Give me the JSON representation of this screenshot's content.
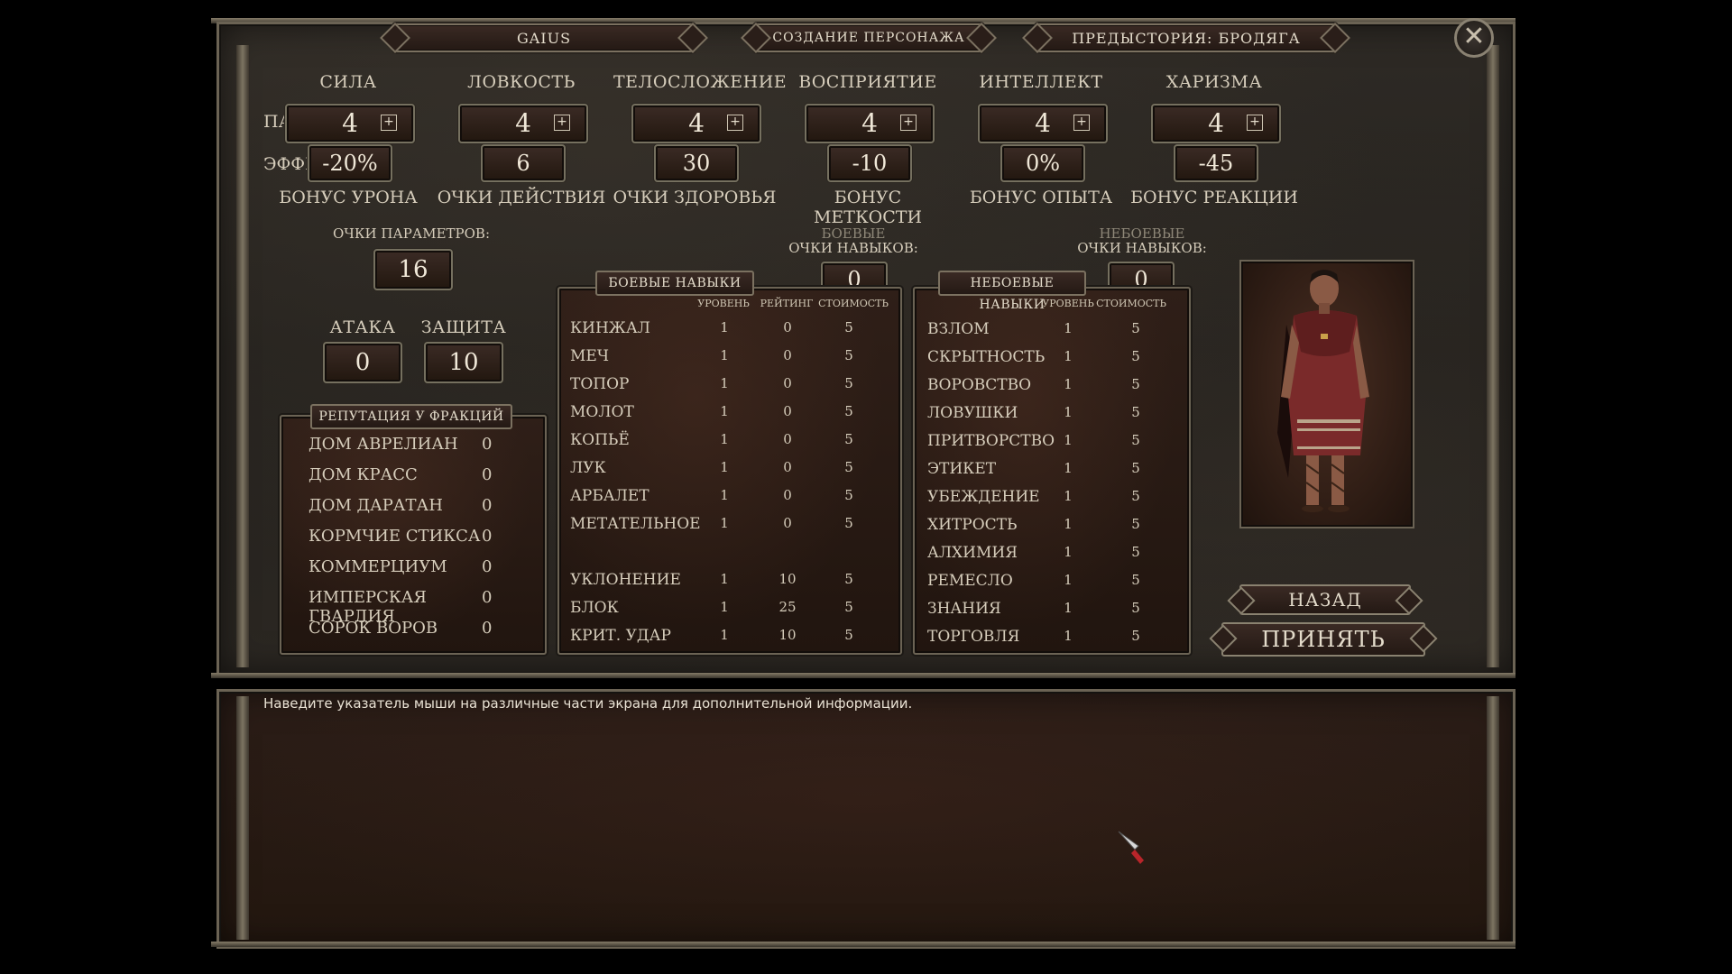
{
  "header": {
    "character_name": "GAIUS",
    "screen_title": "СОЗДАНИЕ ПЕРСОНАЖА",
    "background": "ПРЕДЫСТОРИЯ:  БРОДЯГА"
  },
  "labels": {
    "parameter": "ПАРАМЕТР:",
    "effect": "ЭФФЕКТ:",
    "attribute_points": "ОЧКИ ПАРАМЕТРОВ:",
    "attack": "АТАКА",
    "defense": "ЗАЩИТА",
    "combat_points_line1": "БОЕВЫЕ",
    "combat_points_line2": "ОЧКИ НАВЫКОВ:",
    "noncombat_points_line1": "НЕБОЕВЫЕ",
    "noncombat_points_line2": "ОЧКИ НАВЫКОВ:",
    "reputation": "РЕПУТАЦИЯ У ФРАКЦИЙ",
    "combat_skills": "БОЕВЫЕ НАВЫКИ",
    "noncombat_skills": "НЕБОЕВЫЕ НАВЫКИ",
    "col_level": "УРОВЕНЬ",
    "col_rating": "РЕЙТИНГ",
    "col_cost": "СТОИМОСТЬ",
    "plus": "+"
  },
  "attributes": [
    {
      "name": "СИЛА",
      "value": "4",
      "effect": "-20%",
      "bonus": "БОНУС УРОНА"
    },
    {
      "name": "ЛОВКОСТЬ",
      "value": "4",
      "effect": "6",
      "bonus": "ОЧКИ ДЕЙСТВИЯ"
    },
    {
      "name": "ТЕЛОСЛОЖЕНИЕ",
      "value": "4",
      "effect": "30",
      "bonus": "ОЧКИ ЗДОРОВЬЯ"
    },
    {
      "name": "ВОСПРИЯТИЕ",
      "value": "4",
      "effect": "-10",
      "bonus": "БОНУС МЕТКОСТИ"
    },
    {
      "name": "ИНТЕЛЛЕКТ",
      "value": "4",
      "effect": "0%",
      "bonus": "БОНУС ОПЫТА"
    },
    {
      "name": "ХАРИЗМА",
      "value": "4",
      "effect": "-45",
      "bonus": "БОНУС РЕАКЦИИ"
    }
  ],
  "attribute_points": "16",
  "attack_value": "0",
  "defense_value": "10",
  "combat_skill_points": "0",
  "noncombat_skill_points": "0",
  "reputation": [
    {
      "name": "ДОМ АВРЕЛИАН",
      "value": "0"
    },
    {
      "name": "ДОМ КРАСС",
      "value": "0"
    },
    {
      "name": "ДОМ ДАРАТАН",
      "value": "0"
    },
    {
      "name": "КОРМЧИЕ СТИКСА",
      "value": "0"
    },
    {
      "name": "КОММЕРЦИУМ",
      "value": "0"
    },
    {
      "name": "ИМПЕРСКАЯ ГВАРДИЯ",
      "value": "0"
    },
    {
      "name": "СОРОК ВОРОВ",
      "value": "0"
    }
  ],
  "combat_skills": [
    {
      "name": "КИНЖАЛ",
      "level": "1",
      "rating": "0",
      "cost": "5"
    },
    {
      "name": "МЕЧ",
      "level": "1",
      "rating": "0",
      "cost": "5"
    },
    {
      "name": "ТОПОР",
      "level": "1",
      "rating": "0",
      "cost": "5"
    },
    {
      "name": "МОЛОТ",
      "level": "1",
      "rating": "0",
      "cost": "5"
    },
    {
      "name": "КОПЬЁ",
      "level": "1",
      "rating": "0",
      "cost": "5"
    },
    {
      "name": "ЛУК",
      "level": "1",
      "rating": "0",
      "cost": "5"
    },
    {
      "name": "АРБАЛЕТ",
      "level": "1",
      "rating": "0",
      "cost": "5"
    },
    {
      "name": "МЕТАТЕЛЬНОЕ",
      "level": "1",
      "rating": "0",
      "cost": "5"
    },
    {
      "name": "УКЛОНЕНИЕ",
      "level": "1",
      "rating": "10",
      "cost": "5"
    },
    {
      "name": "БЛОК",
      "level": "1",
      "rating": "25",
      "cost": "5"
    },
    {
      "name": "КРИТ. УДАР",
      "level": "1",
      "rating": "10",
      "cost": "5"
    }
  ],
  "noncombat_skills": [
    {
      "name": "ВЗЛОМ",
      "level": "1",
      "cost": "5"
    },
    {
      "name": "СКРЫТНОСТЬ",
      "level": "1",
      "cost": "5"
    },
    {
      "name": "ВОРОВСТВО",
      "level": "1",
      "cost": "5"
    },
    {
      "name": "ЛОВУШКИ",
      "level": "1",
      "cost": "5"
    },
    {
      "name": "ПРИТВОРСТВО",
      "level": "1",
      "cost": "5"
    },
    {
      "name": "ЭТИКЕТ",
      "level": "1",
      "cost": "5"
    },
    {
      "name": "УБЕЖДЕНИЕ",
      "level": "1",
      "cost": "5"
    },
    {
      "name": "ХИТРОСТЬ",
      "level": "1",
      "cost": "5"
    },
    {
      "name": "АЛХИМИЯ",
      "level": "1",
      "cost": "5"
    },
    {
      "name": "РЕМЕСЛО",
      "level": "1",
      "cost": "5"
    },
    {
      "name": "ЗНАНИЯ",
      "level": "1",
      "cost": "5"
    },
    {
      "name": "ТОРГОВЛЯ",
      "level": "1",
      "cost": "5"
    }
  ],
  "buttons": {
    "back": "НАЗАД",
    "accept": "ПРИНЯТЬ",
    "close": "✕"
  },
  "hint_text": "Наведите указатель мыши на различные части экрана для дополнительной информации."
}
